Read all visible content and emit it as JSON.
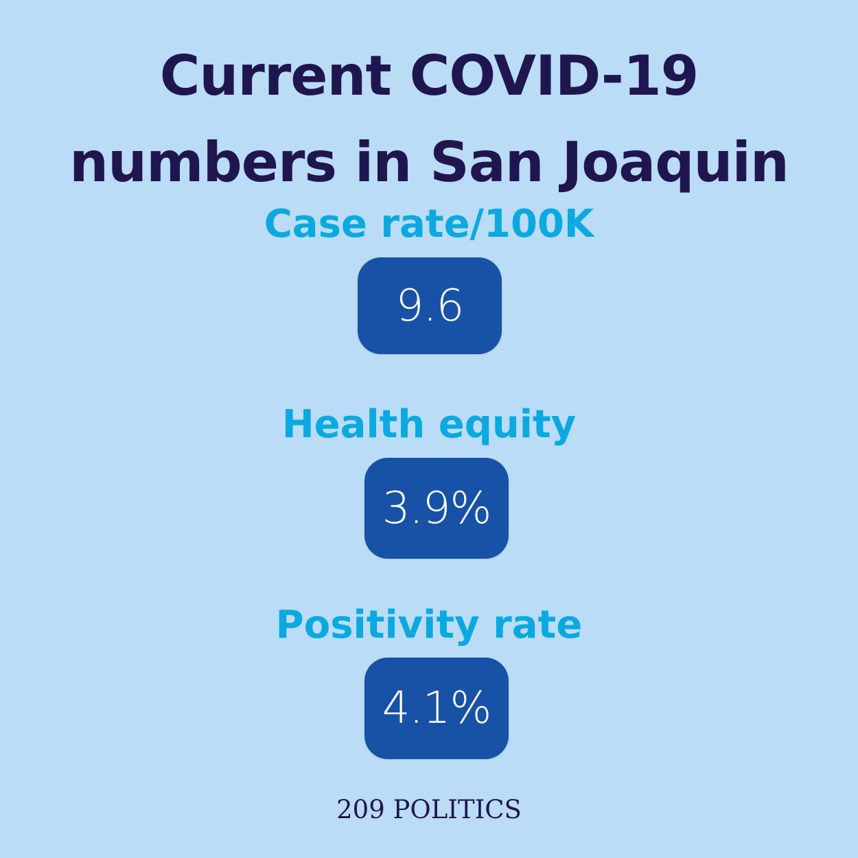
{
  "title": {
    "line1": "Current COVID-19",
    "line2": "numbers in San Joaquin"
  },
  "metrics": [
    {
      "label": "Case rate/100K",
      "value": "9.6"
    },
    {
      "label": "Health equity",
      "value": "3.9%"
    },
    {
      "label": "Positivity rate",
      "value": "4.1%"
    }
  ],
  "footer": "209 POLITICS",
  "colors": {
    "background": "#badcf7",
    "title": "#20164f",
    "label": "#0ba9df",
    "box": "#1752a7",
    "value": "#ffffff"
  }
}
